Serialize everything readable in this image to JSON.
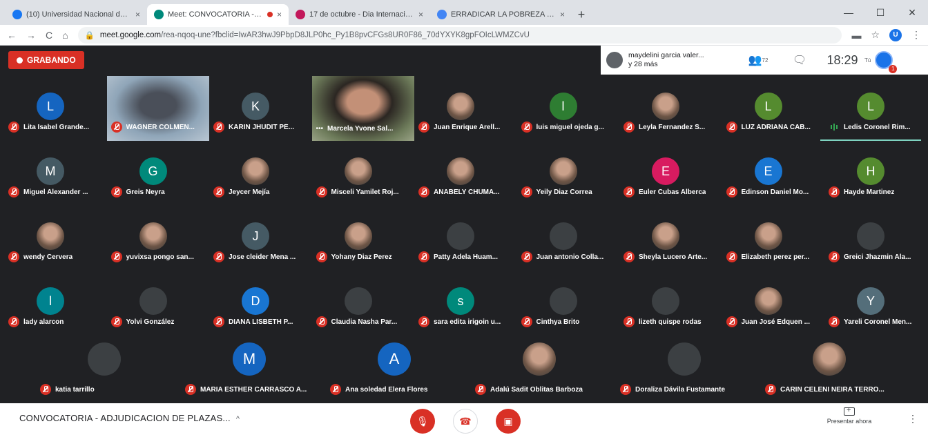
{
  "browser": {
    "tabs": [
      {
        "title": "(10) Universidad Nacional de Jor",
        "icon": "facebook-icon",
        "color": "#1877f2",
        "active": false,
        "close": "×"
      },
      {
        "title": "Meet: CONVOCATORIA - AD",
        "icon": "meet-icon",
        "color": "#00897b",
        "active": true,
        "close": "×"
      },
      {
        "title": "17 de octubre - Dia Internaciona",
        "icon": "site-icon",
        "color": "#c2185b",
        "active": false,
        "close": "×"
      },
      {
        "title": "ERRADICAR LA POBREZA - Busc",
        "icon": "google-icon",
        "color": "#4285f4",
        "active": false,
        "close": "×"
      }
    ],
    "new_tab": "+",
    "window_controls": [
      "—",
      "☐",
      "✕"
    ],
    "nav": [
      "←",
      "→",
      "C",
      "⌂"
    ],
    "url_host": "meet.google.com",
    "url_path": "/rea-nqoq-une?fbclid=IwAR3hwJ9PbpD8JLP0hc_Py1B8pvCFGs8UR0F86_70dYXYK8gpFOIcLWMZCvU",
    "toolbar_right": [
      "▬",
      "☆",
      "⋮"
    ],
    "profile_letter": "U"
  },
  "meet": {
    "recording_label": "GRABANDO",
    "presenter": {
      "name": "maydelini garcia valer...",
      "more": "y 28 más"
    },
    "participants_icon_label": "72",
    "clock": "18:29",
    "self_label": "Tú",
    "notif_count": "1",
    "rows": [
      [
        {
          "name": "Lita Isabel Grande...",
          "type": "letter",
          "letter": "L",
          "color": "#1565c0"
        },
        {
          "name": "WAGNER COLMEN...",
          "type": "video",
          "color": "#8fa5b8"
        },
        {
          "name": "KARIN JHUDIT PÉ...",
          "type": "letter",
          "letter": "K",
          "color": "#455a64"
        },
        {
          "name": "Marcela Yvone Sal...",
          "type": "video2",
          "color": "#6d7b5a"
        },
        {
          "name": "Juan Enrique Arell...",
          "type": "photo"
        },
        {
          "name": "luis miguel ojeda g...",
          "type": "letter",
          "letter": "l",
          "color": "#2e7d32"
        },
        {
          "name": "Leyla Fernandez S...",
          "type": "photo"
        },
        {
          "name": "LUZ ADRIANA CAB...",
          "type": "letter",
          "letter": "L",
          "color": "#558b2f"
        },
        {
          "name": "Ledis Coronel Rim...",
          "type": "letter",
          "letter": "L",
          "color": "#558b2f",
          "speaking": true
        }
      ],
      [
        {
          "name": "Miguel Alexander ...",
          "type": "letter",
          "letter": "M",
          "color": "#455a64"
        },
        {
          "name": "Greis Neyra",
          "type": "letter",
          "letter": "G",
          "color": "#00897b"
        },
        {
          "name": "Jeycer Mejía",
          "type": "photo"
        },
        {
          "name": "Misceli Yamilet Roj...",
          "type": "photo"
        },
        {
          "name": "ANABELY CHUMA...",
          "type": "photo"
        },
        {
          "name": "Yeily Diaz Correa",
          "type": "photo"
        },
        {
          "name": "Euler Cubas Alberca",
          "type": "letter",
          "letter": "E",
          "color": "#d81b60"
        },
        {
          "name": "Edinson Daniel Mo...",
          "type": "letter",
          "letter": "E",
          "color": "#1976d2"
        },
        {
          "name": "Hayde Martinez",
          "type": "letter",
          "letter": "H",
          "color": "#558b2f"
        }
      ],
      [
        {
          "name": "wendy Cervera",
          "type": "photo"
        },
        {
          "name": "yuvixsa pongo san...",
          "type": "photo"
        },
        {
          "name": "Jose cleider Mena ...",
          "type": "letter",
          "letter": "J",
          "color": "#455a64"
        },
        {
          "name": "Yohany Diaz Perez",
          "type": "photo"
        },
        {
          "name": "Patty Adela Huam...",
          "type": "blank"
        },
        {
          "name": "Juan antonio Colla...",
          "type": "blank"
        },
        {
          "name": "Sheyla Lucero Arte...",
          "type": "photo"
        },
        {
          "name": "Elizabeth perez per...",
          "type": "photo"
        },
        {
          "name": "Greici Jhazmin Ala...",
          "type": "blank"
        }
      ],
      [
        {
          "name": "lady alarcon",
          "type": "letter",
          "letter": "l",
          "color": "#00838f"
        },
        {
          "name": "Yolvi González",
          "type": "blank"
        },
        {
          "name": "DIANA LISBETH P...",
          "type": "letter",
          "letter": "D",
          "color": "#1976d2"
        },
        {
          "name": "Claudia Nasha Par...",
          "type": "blank"
        },
        {
          "name": "sara edita irigoin u...",
          "type": "letter",
          "letter": "s",
          "color": "#00897b"
        },
        {
          "name": "Cinthya Brito",
          "type": "blank"
        },
        {
          "name": "lizeth quispe rodas",
          "type": "blank"
        },
        {
          "name": "Juan José Edquen ...",
          "type": "photo"
        },
        {
          "name": "Yareli Coronel Men...",
          "type": "letter",
          "letter": "Y",
          "color": "#546e7a"
        }
      ],
      [
        {
          "name": "katia tarrillo",
          "type": "blank"
        },
        {
          "name": "MARIA ESTHER CARRASCO A...",
          "type": "letter",
          "letter": "M",
          "color": "#1565c0"
        },
        {
          "name": "Ana soledad Elera Flores",
          "type": "letter",
          "letter": "A",
          "color": "#1565c0"
        },
        {
          "name": "Adalú Sadit Oblitas Barboza",
          "type": "photo"
        },
        {
          "name": "Doraliza Dávila Fustamante",
          "type": "blank"
        },
        {
          "name": "CARIN CELENI NEIRA TERRO...",
          "type": "photo"
        }
      ]
    ]
  },
  "bottom": {
    "meeting_title": "CONVOCATORIA - ADJUDICACION DE PLAZAS...",
    "chevron": "^",
    "present_label": "Presentar ahora",
    "kebab": "⋮"
  }
}
